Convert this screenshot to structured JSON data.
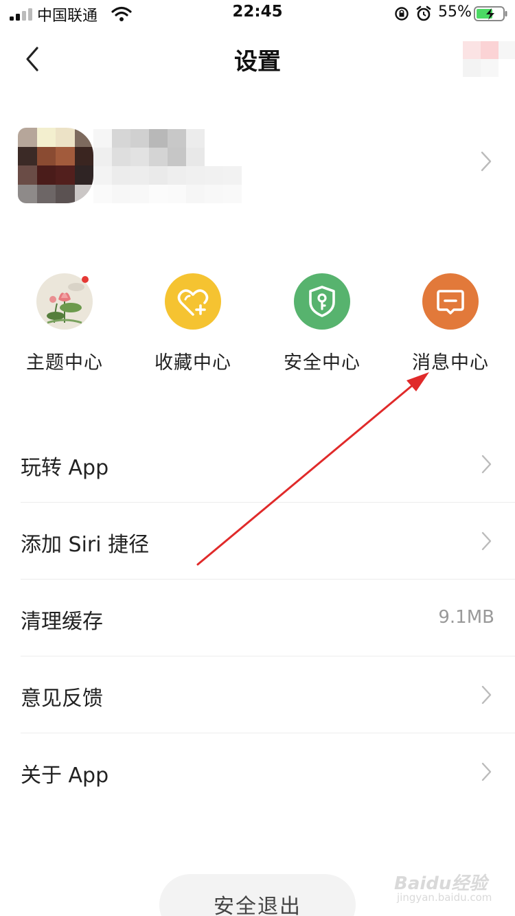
{
  "status_bar": {
    "carrier": "中国联通",
    "time": "22:45",
    "battery_percent": "55%"
  },
  "nav": {
    "title": "设置"
  },
  "quick_actions": [
    {
      "label": "主题中心",
      "icon": "lotus-theme-icon",
      "color": "#ebe6da",
      "badge": true
    },
    {
      "label": "收藏中心",
      "icon": "heart-plus-icon",
      "color": "#f5c331"
    },
    {
      "label": "安全中心",
      "icon": "shield-key-icon",
      "color": "#57b36e"
    },
    {
      "label": "消息中心",
      "icon": "message-icon",
      "color": "#e2793a"
    }
  ],
  "settings": [
    {
      "label": "玩转 App",
      "type": "chevron"
    },
    {
      "label": "添加 Siri 捷径",
      "type": "chevron"
    },
    {
      "label": "清理缓存",
      "type": "value",
      "value": "9.1MB"
    },
    {
      "label": "意见反馈",
      "type": "chevron"
    },
    {
      "label": "关于 App",
      "type": "chevron"
    }
  ],
  "logout_label": "安全退出",
  "watermark": {
    "brand": "Baidu经验",
    "url": "jingyan.baidu.com"
  },
  "colors": {
    "annotation_arrow": "#e02a2a",
    "battery_fill": "#4cd964"
  }
}
